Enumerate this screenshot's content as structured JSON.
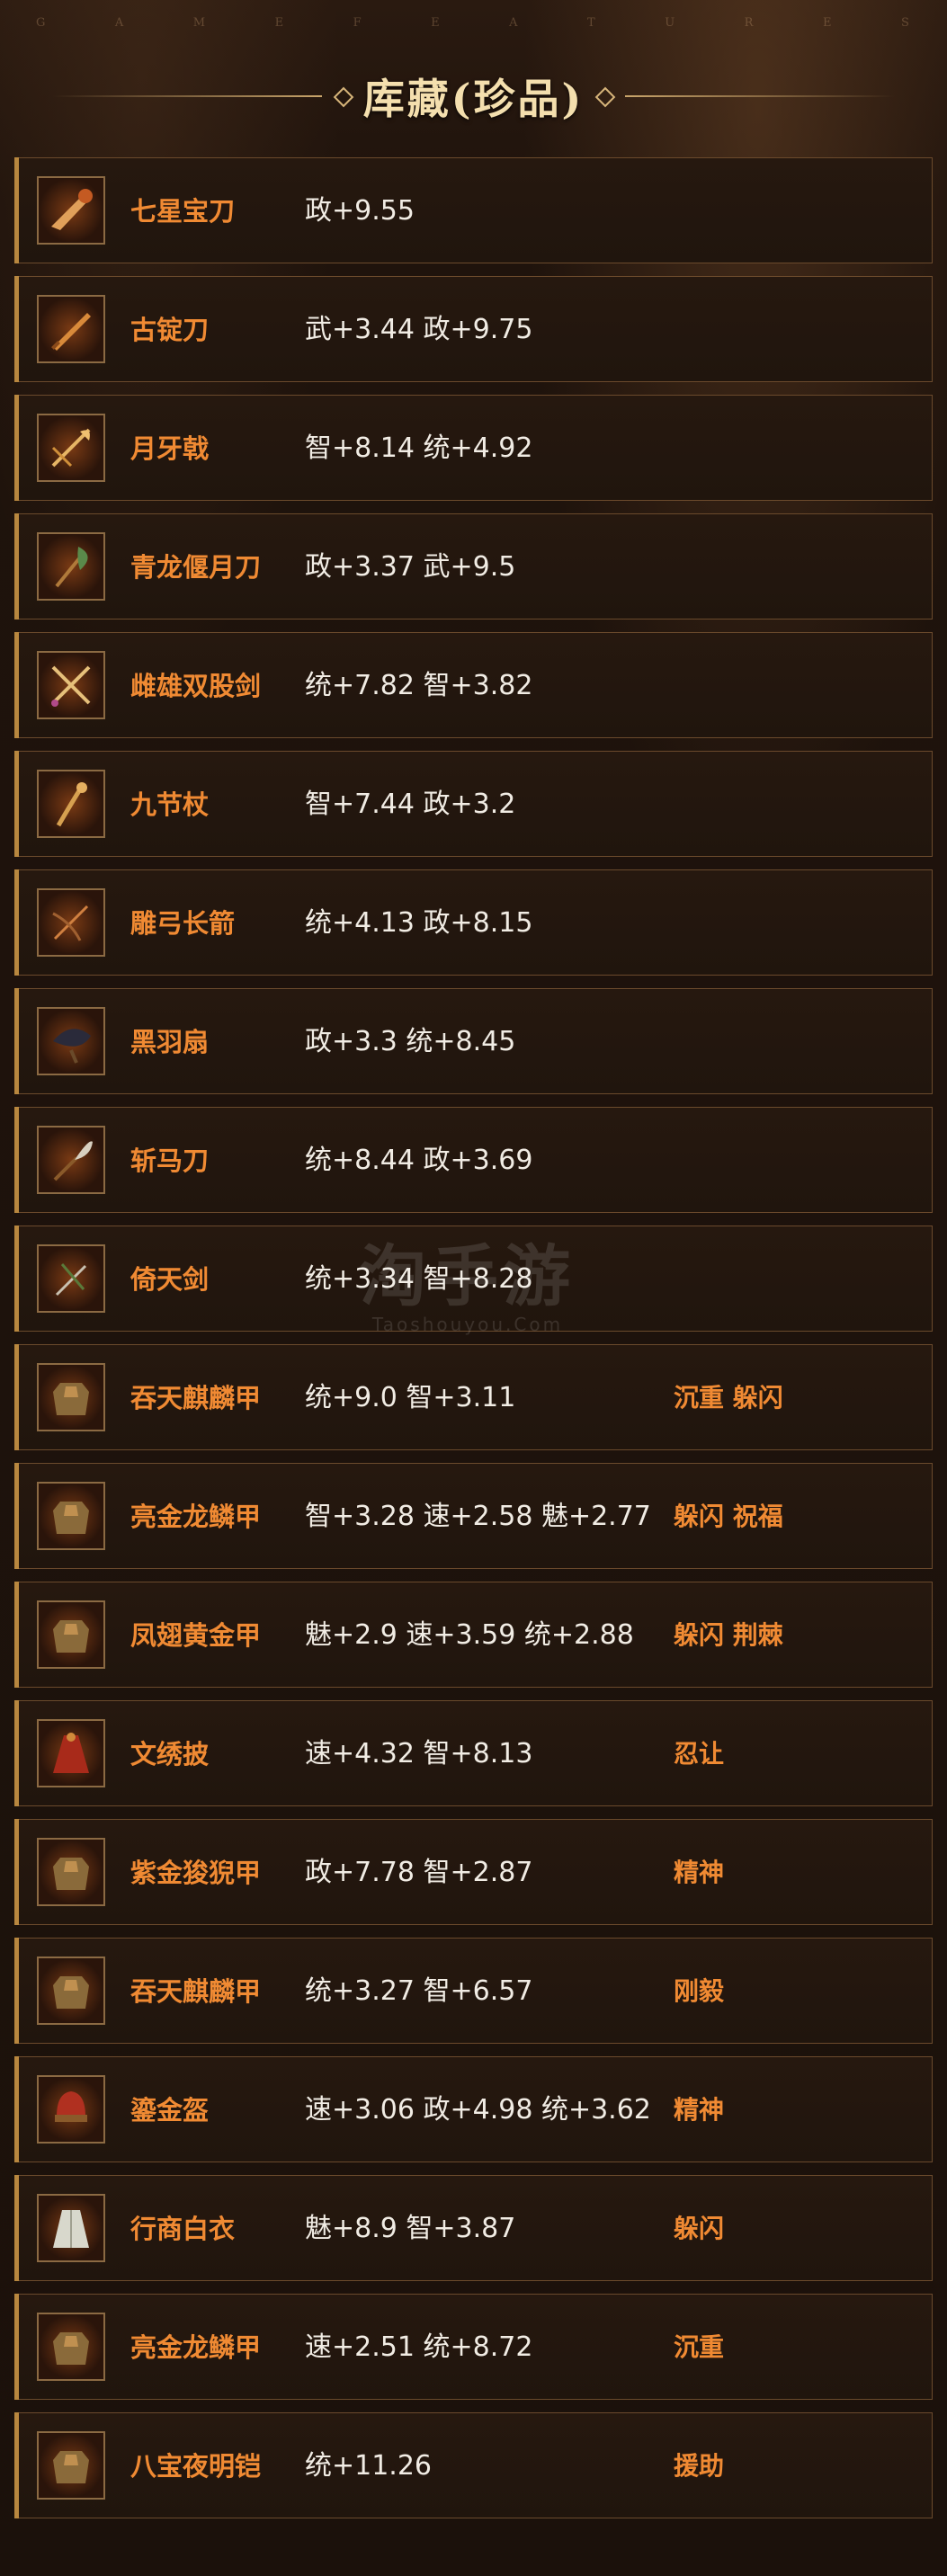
{
  "header": {
    "letters": [
      "G",
      "A",
      "M",
      "E",
      "F",
      "E",
      "A",
      "T",
      "U",
      "R",
      "E",
      "S"
    ],
    "title": "库藏(珍品)"
  },
  "watermark": {
    "main": "淘手游",
    "sub": "Taoshouyou.Com"
  },
  "colors": {
    "name": "#f08a33",
    "stats": "#f1ece4",
    "title": "#f4dfae",
    "border": "#6b4a2c",
    "accent": "#b8873f"
  },
  "items": [
    {
      "icon": "dragon-blade-icon",
      "name": "七星宝刀",
      "stats": "政+9.55",
      "traits": ""
    },
    {
      "icon": "sword-icon",
      "name": "古锭刀",
      "stats": "武+3.44 政+9.75",
      "traits": ""
    },
    {
      "icon": "halberd-icon",
      "name": "月牙戟",
      "stats": "智+8.14 统+4.92",
      "traits": ""
    },
    {
      "icon": "glaive-icon",
      "name": "青龙偃月刀",
      "stats": "政+3.37 武+9.5",
      "traits": ""
    },
    {
      "icon": "twin-swords-icon",
      "name": "雌雄双股剑",
      "stats": "统+7.82 智+3.82",
      "traits": ""
    },
    {
      "icon": "staff-icon",
      "name": "九节杖",
      "stats": "智+7.44 政+3.2",
      "traits": ""
    },
    {
      "icon": "bow-arrow-icon",
      "name": "雕弓长箭",
      "stats": "统+4.13 政+8.15",
      "traits": ""
    },
    {
      "icon": "feather-fan-icon",
      "name": "黑羽扇",
      "stats": "政+3.3 统+8.45",
      "traits": ""
    },
    {
      "icon": "horse-blade-icon",
      "name": "斩马刀",
      "stats": "统+8.44 政+3.69",
      "traits": ""
    },
    {
      "icon": "heaven-sword-icon",
      "name": "倚天剑",
      "stats": "统+3.34 智+8.28",
      "traits": ""
    },
    {
      "icon": "armor-icon",
      "name": "吞天麒麟甲",
      "stats": "统+9.0 智+3.11",
      "traits": "沉重 躲闪"
    },
    {
      "icon": "armor-icon",
      "name": "亮金龙鳞甲",
      "stats": "智+3.28 速+2.58 魅+2.77",
      "traits": "躲闪 祝福"
    },
    {
      "icon": "armor-icon",
      "name": "凤翅黄金甲",
      "stats": "魅+2.9 速+3.59 统+2.88",
      "traits": "躲闪 荆棘"
    },
    {
      "icon": "cloak-icon",
      "name": "文绣披",
      "stats": "速+4.32 智+8.13",
      "traits": "忍让"
    },
    {
      "icon": "armor-icon",
      "name": "紫金狻猊甲",
      "stats": "政+7.78 智+2.87",
      "traits": "精神"
    },
    {
      "icon": "armor-icon",
      "name": "吞天麒麟甲",
      "stats": "统+3.27 智+6.57",
      "traits": "刚毅"
    },
    {
      "icon": "helmet-icon",
      "name": "鎏金盔",
      "stats": "速+3.06 政+4.98 统+3.62",
      "traits": "精神"
    },
    {
      "icon": "robe-icon",
      "name": "行商白衣",
      "stats": "魅+8.9 智+3.87",
      "traits": "躲闪"
    },
    {
      "icon": "armor-icon",
      "name": "亮金龙鳞甲",
      "stats": "速+2.51 统+8.72",
      "traits": "沉重"
    },
    {
      "icon": "armor-icon",
      "name": "八宝夜明铠",
      "stats": "统+11.26",
      "traits": "援助"
    }
  ]
}
